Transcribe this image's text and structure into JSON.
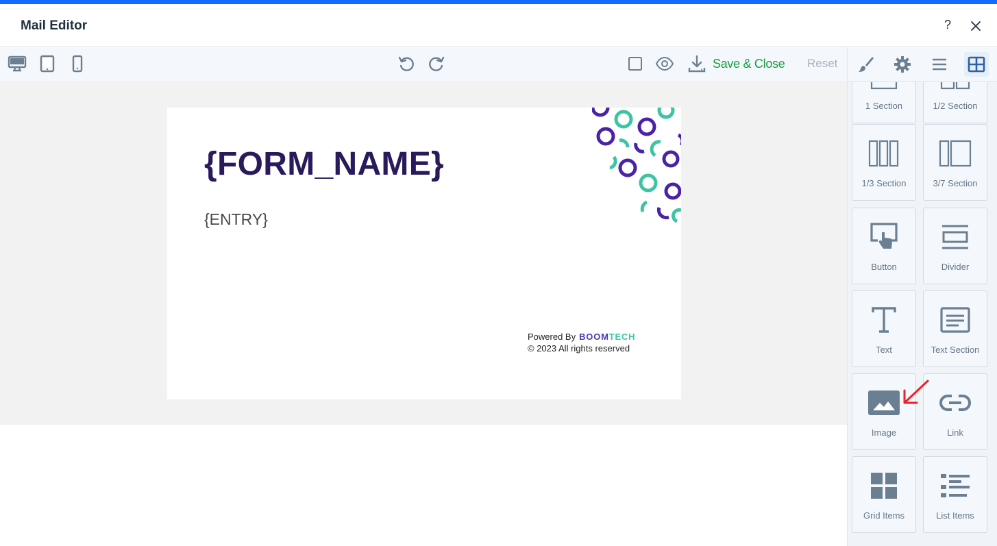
{
  "window": {
    "title": "Mail Editor",
    "help_label": "?"
  },
  "toolbar": {
    "device_icons": [
      "desktop-icon",
      "tablet-icon",
      "mobile-icon"
    ],
    "undo_icon": "undo-icon",
    "redo_icon": "redo-icon",
    "save_label": "Save & Close",
    "reset_label": "Reset"
  },
  "email": {
    "heading": "{FORM_NAME}",
    "body": "{ENTRY}",
    "footer_powered": "Powered By",
    "brand_part1": "BOOM",
    "brand_part2": "TECH",
    "footer_rights": "© 2023 All rights reserved"
  },
  "sidebar": {
    "tabs": [
      "brush-icon",
      "gear-icon",
      "menu-icon",
      "blocks-icon"
    ],
    "active_tab": "blocks-icon",
    "tiles": [
      {
        "label": "1 Section",
        "icon": "one-section-icon"
      },
      {
        "label": "1/2 Section",
        "icon": "half-section-icon"
      },
      {
        "label": "1/3 Section",
        "icon": "third-section-icon"
      },
      {
        "label": "3/7 Section",
        "icon": "three-seven-section-icon"
      },
      {
        "label": "Button",
        "icon": "button-icon"
      },
      {
        "label": "Divider",
        "icon": "divider-icon"
      },
      {
        "label": "Text",
        "icon": "text-icon"
      },
      {
        "label": "Text Section",
        "icon": "text-section-icon"
      },
      {
        "label": "Image",
        "icon": "image-icon"
      },
      {
        "label": "Link",
        "icon": "link-icon"
      },
      {
        "label": "Grid Items",
        "icon": "grid-items-icon"
      },
      {
        "label": "List Items",
        "icon": "list-items-icon"
      }
    ]
  },
  "colors": {
    "accent": "#116dff",
    "save": "#1a9c3e",
    "heading": "#2a1a5c",
    "icon": "#6b7f92",
    "annotation_arrow": "#e8242b"
  }
}
